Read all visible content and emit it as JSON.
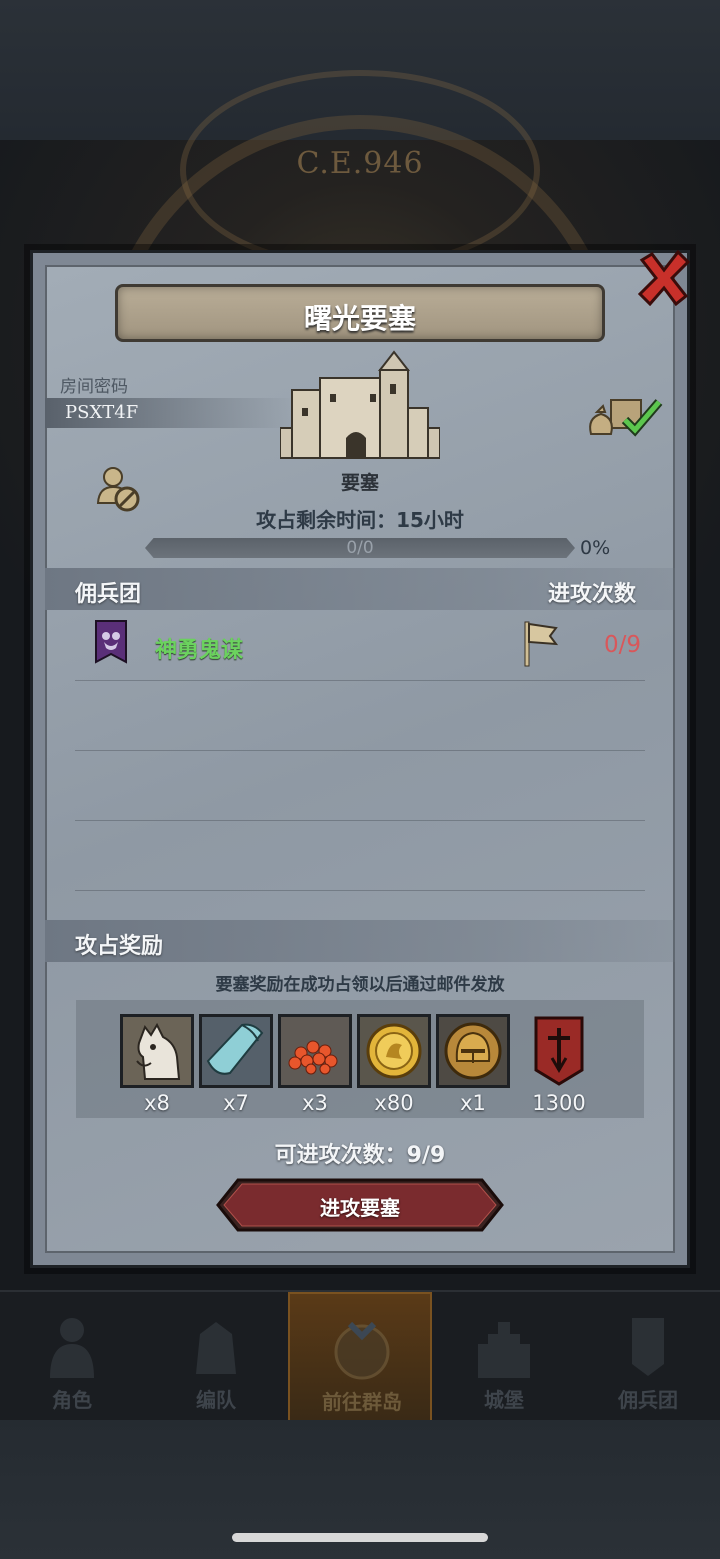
{
  "background": {
    "era": "C.E.946"
  },
  "modal": {
    "title": "曙光要塞",
    "room_label": "房间密码",
    "room_code": "PSXT4F",
    "fortress_label": "要塞",
    "time_label": "攻占剩余时间：",
    "time_value": "15小时",
    "progress_text": "0/0",
    "progress_percent": "0%",
    "progress_fraction": 0,
    "guild_section": {
      "left_title": "佣兵团",
      "right_title": "进攻次数"
    },
    "guild_rows": [
      {
        "name": "神勇鬼谋",
        "attacks": "0/9"
      }
    ],
    "reward_section": {
      "title": "攻占奖励",
      "note": "要塞奖励在成功占领以后通过邮件发放",
      "items": [
        {
          "icon": "horse-icon",
          "qty": "x8"
        },
        {
          "icon": "cloth-icon",
          "qty": "x7"
        },
        {
          "icon": "caviar-icon",
          "qty": "x3"
        },
        {
          "icon": "gold-coin-icon",
          "qty": "x80"
        },
        {
          "icon": "helmet-coin-icon",
          "qty": "x1"
        },
        {
          "icon": "guild-banner-icon",
          "qty": "1300"
        }
      ]
    },
    "attempts_label": "可进攻次数：",
    "attempts_value": "9/9",
    "attack_button": "进攻要塞"
  },
  "bottom_nav": [
    {
      "label": "角色",
      "icon": "knight-icon",
      "active": false
    },
    {
      "label": "编队",
      "icon": "team-icon",
      "active": false
    },
    {
      "label": "前往群岛",
      "icon": "compass-icon",
      "active": true
    },
    {
      "label": "城堡",
      "icon": "castle-icon",
      "active": false
    },
    {
      "label": "佣兵团",
      "icon": "guild-icon",
      "active": false
    }
  ],
  "colors": {
    "guild_name": "#6bd25e",
    "attack_count": "#d9575a",
    "close_x": "#c8302a",
    "button_red": "#7a2b2e"
  }
}
